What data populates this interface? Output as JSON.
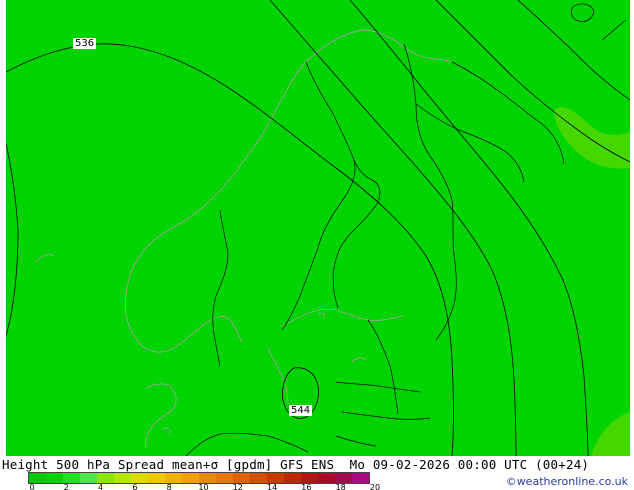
{
  "caption": "Height 500 hPa Spread mean+σ [gpdm] GFS ENS  Mo 09-02-2026 00:00 UTC (00+24)",
  "contours": [
    {
      "label": "536"
    },
    {
      "label": "544"
    }
  ],
  "legend": {
    "ticks": [
      "0",
      "2",
      "4",
      "6",
      "8",
      "10",
      "12",
      "14",
      "16",
      "18",
      "20"
    ],
    "colors": [
      "#00c800",
      "#00d400",
      "#1ee01e",
      "#50e650",
      "#8ce600",
      "#b4e600",
      "#dcdc00",
      "#f0c800",
      "#f0b400",
      "#f0a000",
      "#e68c00",
      "#e67800",
      "#dc6400",
      "#d25000",
      "#c83c00",
      "#be2800",
      "#b41414",
      "#aa0a28",
      "#a00a50",
      "#aa0a82"
    ]
  },
  "colors": {
    "map_fill": "#00d400",
    "high_spread_fill": "#44d800",
    "coastline": "#a0a0a0",
    "border": "#000000",
    "contour": "#000000",
    "credit": "#2a3aa8"
  },
  "credit": "©weatheronline.co.uk"
}
